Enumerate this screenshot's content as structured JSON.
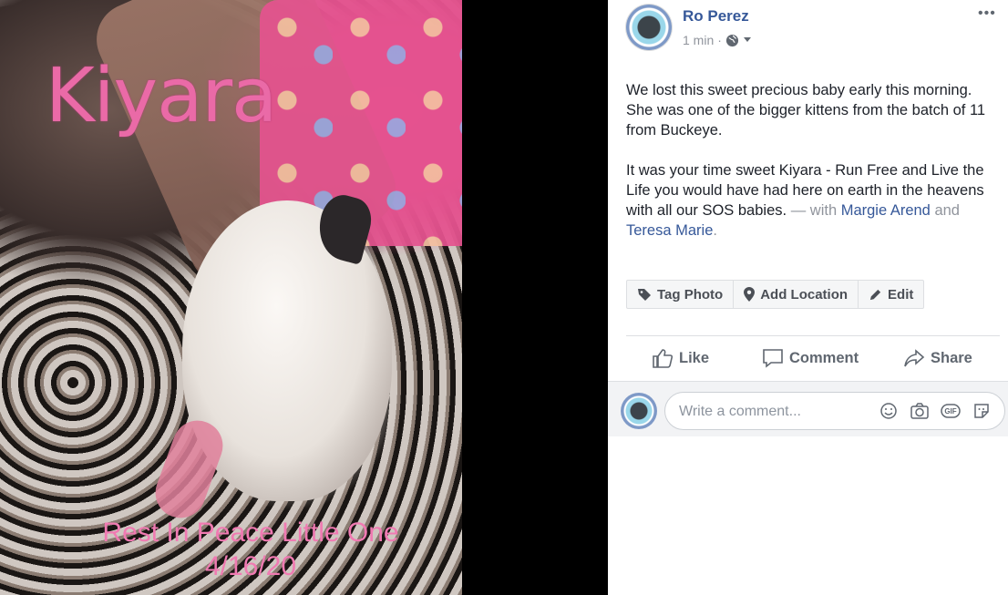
{
  "photo": {
    "overlay_name": "Kiyara",
    "overlay_line1": "Rest In Peace Little One",
    "overlay_date": "4/16/20"
  },
  "post": {
    "author": "Ro Perez",
    "time": "1 min",
    "separator": "·",
    "privacy_icon": "globe-icon",
    "more_icon": "•••",
    "paragraph1": "We lost this sweet precious baby early this morning. She was one of the bigger kittens from the batch of 11 from Buckeye.",
    "paragraph2": "It was your time sweet Kiyara - Run Free and Live the Life you would have had here on earth in the heavens with all our SOS babies.",
    "with_text": "— with",
    "tag1": "Margie Arend",
    "and_text": "and",
    "tag2": "Teresa Marie",
    "end_text": "."
  },
  "photo_actions": {
    "tag_photo": "Tag Photo",
    "add_location": "Add Location",
    "edit": "Edit"
  },
  "reactions": {
    "like": "Like",
    "comment": "Comment",
    "share": "Share"
  },
  "comment_box": {
    "placeholder": "Write a comment...",
    "gif_label": "GIF"
  },
  "colors": {
    "link": "#365899",
    "muted": "#90949c",
    "overlay_pink": "#ea6aa7"
  }
}
